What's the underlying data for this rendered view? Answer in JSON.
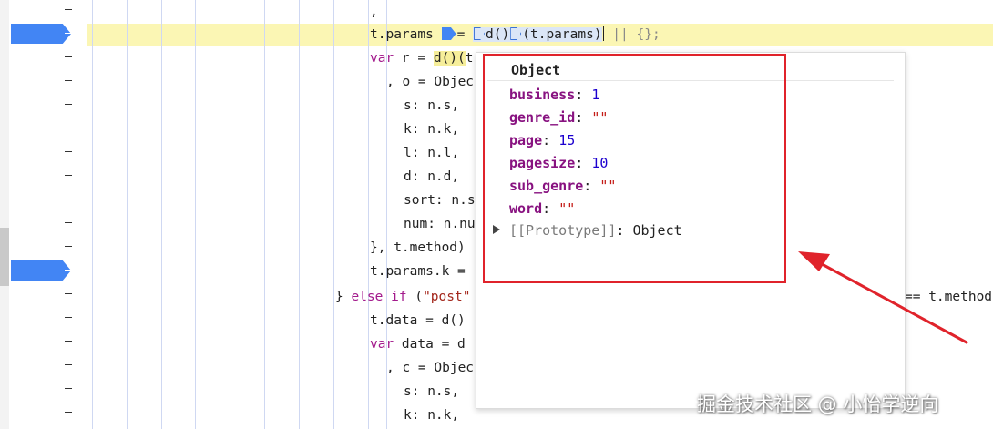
{
  "code_lines": {
    "l0": ",",
    "l1_a": "t.params ",
    "l1_b": "= ",
    "l1_c": "d()",
    "l1_d": "(t.params)",
    "l1_e": " || {};",
    "l2_kw": "var",
    "l2_rest": " r = ",
    "l2_fn": "d()(",
    "l2_tail": "t",
    "l3": ", o = Objec",
    "l4": "s: n.s,",
    "l5": "k: n.k,",
    "l6": "l: n.l,",
    "l7": "d: n.d,",
    "l8": "sort: n.s",
    "l9": "num: n.nu",
    "l10": "}, t.method)",
    "l11": "t.params.k =",
    "l12_a": "} ",
    "l12_kw1": "else",
    "l12_b": " ",
    "l12_kw2": "if",
    "l12_c": " (",
    "l12_str": "\"post\"",
    "l12_right": "== t.method",
    "l13": "t.data = d()",
    "l14_kw": "var",
    "l14_rest": " data = d",
    "l15": ", c = Objec",
    "l16": "s: n.s,",
    "l17": "k: n.k,"
  },
  "popup": {
    "title": "Object",
    "props": [
      {
        "key": "business",
        "sep": ": ",
        "value": "1",
        "kind": "num"
      },
      {
        "key": "genre_id",
        "sep": ": ",
        "value": "\"\"",
        "kind": "str"
      },
      {
        "key": "page",
        "sep": ": ",
        "value": "15",
        "kind": "num"
      },
      {
        "key": "pagesize",
        "sep": ": ",
        "value": "10",
        "kind": "num"
      },
      {
        "key": "sub_genre",
        "sep": ": ",
        "value": "\"\"",
        "kind": "str"
      },
      {
        "key": "word",
        "sep": ": ",
        "value": "\"\"",
        "kind": "str"
      }
    ],
    "prototype_key": "[[Prototype]]",
    "prototype_value": ": Object"
  },
  "watermark": "掘金技术社区 @ 小怡学逆向",
  "colors": {
    "breakpoint": "#4285f4",
    "highlight_line": "#fbf6b4",
    "annotation": "#e0232b"
  }
}
